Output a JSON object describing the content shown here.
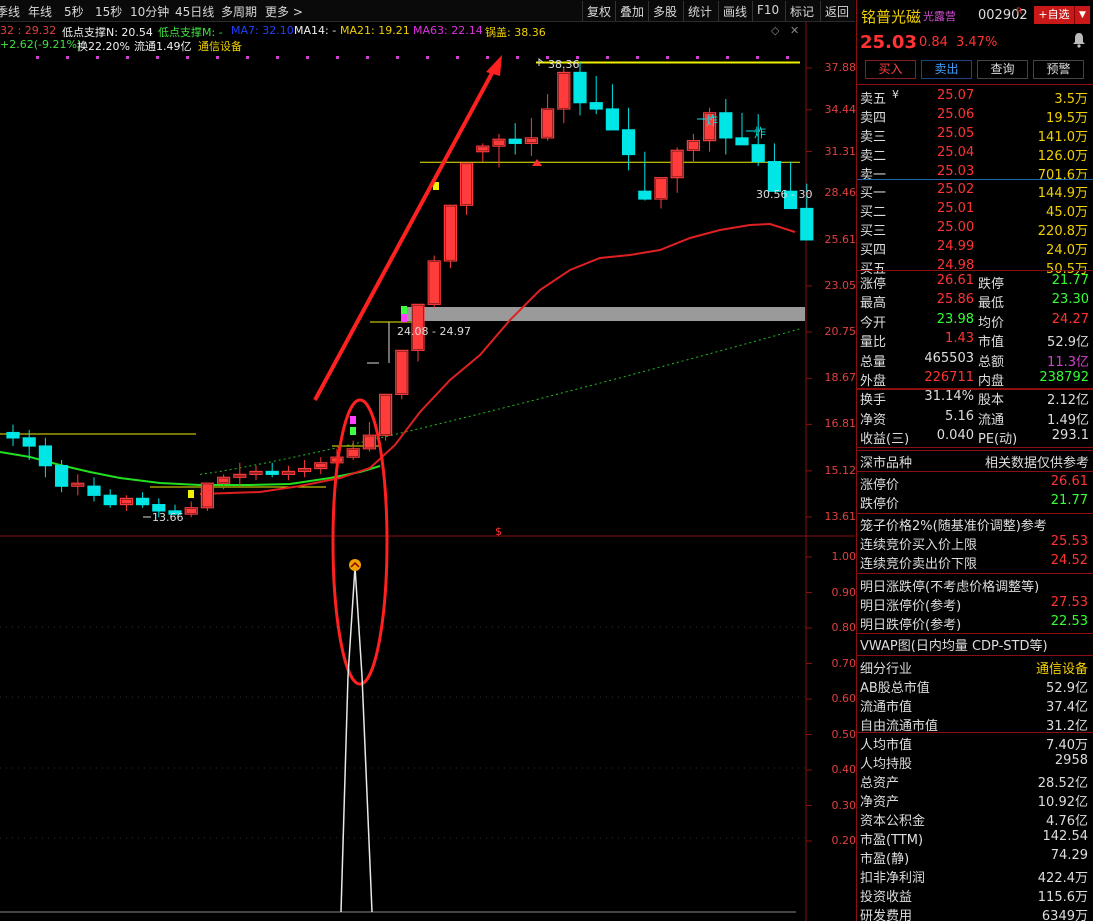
{
  "toolbar": {
    "left": [
      "季线",
      "年线",
      "5秒",
      "15秒",
      "10分钟",
      "45日线",
      "多周期",
      "更多 >"
    ],
    "right": [
      "复权",
      "叠加",
      "多股",
      "统计",
      "画线",
      "F10",
      "标记",
      "返回"
    ]
  },
  "indicators": {
    "line1": [
      {
        "text": "32 : 29.32",
        "color": "#e04040"
      },
      {
        "text": "低点支撑N: 20.54",
        "color": "#f0f0f0"
      },
      {
        "text": "低点支撑M: -",
        "color": "#40e040"
      },
      {
        "text": "MA7: 32.10",
        "color": "#2040ff"
      },
      {
        "text": "MA14: -",
        "color": "#f0f0f0"
      },
      {
        "text": "MA21: 19.21",
        "color": "#f0d000"
      },
      {
        "text": "MA63: 22.14",
        "color": "#e030e0"
      },
      {
        "text": "锅盖: 38.36",
        "color": "#f0d000"
      }
    ],
    "line2": [
      {
        "text": "+2.62(-9.21%)",
        "color": "#40e040"
      },
      {
        "text": "换22.20%",
        "color": "#f0f0f0"
      },
      {
        "text": "流通1.49亿",
        "color": "#f0f0f0"
      },
      {
        "text": "通信设备",
        "color": "#f0d000"
      }
    ]
  },
  "chart": {
    "y_axis": [
      "37.88",
      "34.44",
      "31.31",
      "28.46",
      "25.61",
      "23.05",
      "20.75",
      "18.67",
      "16.81",
      "15.12",
      "13.61"
    ],
    "osc_axis": [
      "1.00",
      "0.90",
      "0.80",
      "0.70",
      "0.60",
      "0.50",
      "0.40",
      "0.30",
      "0.20"
    ],
    "annotations": {
      "high": "38.36",
      "low": "13.66",
      "gap": "24.08 - 24.97",
      "support": "30.56 - 30",
      "burst_1": "炸",
      "burst_2": "炸",
      "signal": "$"
    },
    "colors": {
      "up": "#ff3b3b",
      "down": "#00e5e5",
      "ma_red": "#e02020",
      "ma_green": "#20e020",
      "ma_dotted": "#20c020",
      "accent": "#ff2020",
      "yellow": "#f0f000"
    }
  },
  "chart_data": {
    "type": "candlestick",
    "x": [
      1,
      2,
      3,
      4,
      5,
      6,
      7,
      8,
      9,
      10,
      11,
      12,
      13,
      14,
      15,
      16,
      17,
      18,
      19,
      20,
      21,
      22,
      23,
      24,
      25,
      26,
      27,
      28,
      29,
      30,
      31,
      32,
      33,
      34,
      35,
      36,
      37,
      38,
      39,
      40,
      41,
      42,
      43,
      44,
      45,
      46,
      47,
      48,
      49,
      50
    ],
    "open": [
      16.5,
      16.3,
      16.0,
      15.3,
      14.6,
      14.6,
      14.3,
      14.0,
      14.2,
      14.0,
      13.8,
      13.7,
      13.9,
      14.7,
      14.9,
      15.0,
      15.1,
      15.0,
      15.1,
      15.2,
      15.4,
      15.6,
      15.9,
      16.4,
      18.0,
      19.9,
      22.1,
      24.4,
      27.7,
      31.3,
      31.7,
      32.2,
      31.9,
      32.3,
      34.5,
      37.5,
      35.0,
      34.5,
      32.9,
      28.6,
      28.1,
      29.5,
      31.4,
      32.1,
      34.2,
      32.3,
      31.8,
      30.6,
      28.6,
      27.5
    ],
    "high": [
      16.8,
      16.6,
      16.3,
      15.5,
      15.0,
      14.9,
      14.5,
      14.3,
      14.4,
      14.2,
      14.0,
      14.1,
      14.4,
      15.0,
      15.4,
      15.3,
      15.4,
      15.3,
      15.5,
      15.6,
      15.9,
      16.2,
      16.9,
      17.9,
      19.9,
      21.9,
      24.7,
      27.1,
      30.5,
      31.9,
      32.6,
      33.4,
      33.8,
      35.7,
      37.9,
      38.4,
      37.2,
      36.5,
      34.6,
      31.3,
      29.3,
      31.6,
      32.6,
      34.6,
      35.3,
      34.2,
      34.1,
      31.9,
      30.6,
      29.1
    ],
    "low": [
      16.0,
      15.5,
      14.9,
      14.4,
      14.3,
      14.1,
      13.9,
      13.8,
      13.9,
      13.6,
      13.66,
      13.6,
      13.8,
      14.5,
      14.6,
      14.8,
      14.9,
      14.8,
      14.9,
      15.0,
      15.2,
      15.5,
      15.8,
      16.2,
      17.8,
      19.4,
      21.9,
      24.0,
      27.1,
      30.6,
      30.2,
      31.1,
      31.0,
      32.1,
      33.4,
      34.0,
      34.1,
      33.3,
      30.0,
      28.0,
      27.5,
      28.5,
      30.5,
      31.3,
      31.1,
      31.8,
      30.3,
      29.1,
      27.7,
      25.6
    ],
    "close": [
      16.3,
      16.0,
      15.3,
      14.6,
      14.7,
      14.3,
      14.0,
      14.2,
      14.0,
      13.8,
      13.7,
      13.9,
      14.7,
      14.9,
      15.0,
      15.1,
      15.0,
      15.1,
      15.2,
      15.4,
      15.6,
      15.9,
      16.4,
      18.0,
      19.9,
      22.1,
      24.4,
      27.7,
      30.5,
      31.7,
      32.2,
      31.9,
      32.3,
      34.5,
      37.5,
      35.0,
      34.5,
      32.9,
      31.1,
      28.1,
      29.5,
      31.4,
      32.1,
      34.2,
      32.3,
      31.8,
      30.6,
      28.6,
      27.5,
      25.6
    ],
    "title": "",
    "xlabel": "",
    "ylabel": ""
  },
  "right_panel": {
    "name": "铭普光磁",
    "tag": "光露营",
    "code": "002902",
    "badge": "R",
    "fav": "+自选",
    "price": "25.03",
    "change": "0.84",
    "pct": "3.47%",
    "trade_buttons": [
      "买入",
      "卖出",
      "查询",
      "预警"
    ],
    "asks": [
      {
        "label": "卖五",
        "price": "25.07",
        "vol": "3.5万"
      },
      {
        "label": "卖四",
        "price": "25.06",
        "vol": "19.5万"
      },
      {
        "label": "卖三",
        "price": "25.05",
        "vol": "141.0万"
      },
      {
        "label": "卖二",
        "price": "25.04",
        "vol": "126.0万"
      },
      {
        "label": "卖一",
        "price": "25.03",
        "vol": "701.6万"
      }
    ],
    "bids": [
      {
        "label": "买一",
        "price": "25.02",
        "vol": "144.9万"
      },
      {
        "label": "买二",
        "price": "25.01",
        "vol": "45.0万"
      },
      {
        "label": "买三",
        "price": "25.00",
        "vol": "220.8万"
      },
      {
        "label": "买四",
        "price": "24.99",
        "vol": "24.0万"
      },
      {
        "label": "买五",
        "price": "24.98",
        "vol": "50.5万"
      }
    ],
    "stats_rows": [
      {
        "k1": "涨停",
        "v1": "26.61",
        "c1": "#ff3333",
        "k2": "跌停",
        "v2": "21.77",
        "c2": "#33ff33"
      },
      {
        "k1": "最高",
        "v1": "25.86",
        "c1": "#ff3333",
        "k2": "最低",
        "v2": "23.30",
        "c2": "#33ff33"
      },
      {
        "k1": "今开",
        "v1": "23.98",
        "c1": "#33ff33",
        "k2": "均价",
        "v2": "24.27",
        "c2": "#ff3333"
      },
      {
        "k1": "量比",
        "v1": "1.43",
        "c1": "#ff3333",
        "k2": "市值",
        "v2": "52.9亿",
        "c2": "#dddddd"
      },
      {
        "k1": "总量",
        "v1": "465503",
        "c1": "#dddddd",
        "k2": "总额",
        "v2": "11.3亿",
        "c2": "#d040d0"
      },
      {
        "k1": "外盘",
        "v1": "226711",
        "c1": "#ff3333",
        "k2": "内盘",
        "v2": "238792",
        "c2": "#33ff33"
      },
      {
        "k1": "换手",
        "v1": "31.14%",
        "c1": "#dddddd",
        "k2": "股本",
        "v2": "2.12亿",
        "c2": "#dddddd"
      },
      {
        "k1": "净资",
        "v1": "5.16",
        "c1": "#dddddd",
        "k2": "流通",
        "v2": "1.49亿",
        "c2": "#dddddd"
      },
      {
        "k1": "收益(三)",
        "v1": "0.040",
        "c1": "#dddddd",
        "k2": "PE(动)",
        "v2": "293.1",
        "c2": "#dddddd"
      }
    ],
    "market_kind": "深市品种",
    "market_ref": "相关数据仅供参考",
    "limit_up_label": "涨停价",
    "limit_up": "26.61",
    "limit_down_label": "跌停价",
    "limit_down": "21.77",
    "cage_title": "笼子价格2%(随基准价调整)参考",
    "cage_buy_label": "连续竞价买入价上限",
    "cage_buy": "25.53",
    "cage_sell_label": "连续竞价卖出价下限",
    "cage_sell": "24.52",
    "next_title": "明日涨跌停(不考虑价格调整等)",
    "next_up_label": "明日涨停价(参考)",
    "next_up": "27.53",
    "next_down_label": "明日跌停价(参考)",
    "next_down": "22.53",
    "vwap_title": "VWAP图(日内均量 CDP-STD等)",
    "industry_label": "细分行业",
    "industry": "通信设备",
    "fund_rows": [
      {
        "k": "AB股总市值",
        "v": "52.9亿"
      },
      {
        "k": "流通市值",
        "v": "37.4亿"
      },
      {
        "k": "自由流通市值",
        "v": "31.2亿"
      },
      {
        "k": "人均市值",
        "v": "7.40万"
      },
      {
        "k": "人均持股",
        "v": "2958"
      },
      {
        "k": "总资产",
        "v": "28.52亿"
      },
      {
        "k": "净资产",
        "v": "10.92亿"
      },
      {
        "k": "资本公积金",
        "v": "4.76亿"
      },
      {
        "k": "市盈(TTM)",
        "v": "142.54"
      },
      {
        "k": "市盈(静)",
        "v": "74.29"
      },
      {
        "k": "扣非净利润",
        "v": "422.4万"
      },
      {
        "k": "投资收益",
        "v": "115.6万"
      },
      {
        "k": "研发费用",
        "v": "6349万"
      }
    ]
  }
}
